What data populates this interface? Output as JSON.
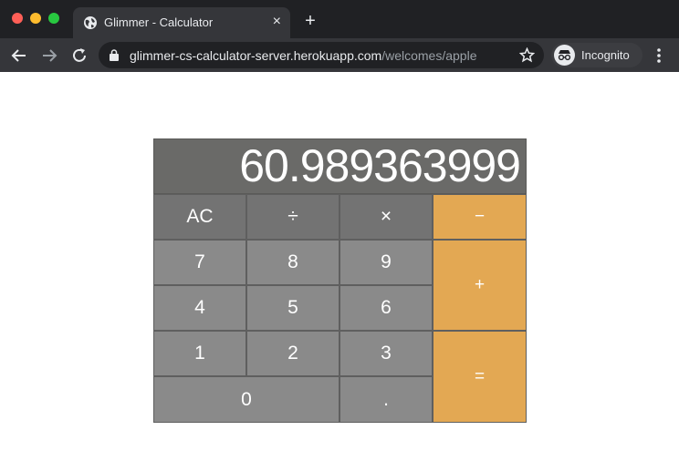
{
  "browser": {
    "tab_title": "Glimmer - Calculator",
    "tab_close": "×",
    "new_tab": "+",
    "url_host": "glimmer-cs-calculator-server.herokuapp.com",
    "url_path": "/welcomes/apple",
    "incognito_label": "Incognito",
    "colors": {
      "titlebar": "#202124",
      "toolbar": "#35363a",
      "text": "#e8eaed"
    }
  },
  "calculator": {
    "display": "60.989363999",
    "keys": {
      "ac": "AC",
      "divide": "÷",
      "multiply": "×",
      "subtract": "−",
      "seven": "7",
      "eight": "8",
      "nine": "9",
      "add": "+",
      "four": "4",
      "five": "5",
      "six": "6",
      "one": "1",
      "two": "2",
      "three": "3",
      "equals": "=",
      "zero": "0",
      "decimal": "."
    },
    "colors": {
      "display": "#6a6a68",
      "function_key": "#737373",
      "number_key": "#8a8a8a",
      "operator_key": "#e3a853"
    }
  }
}
